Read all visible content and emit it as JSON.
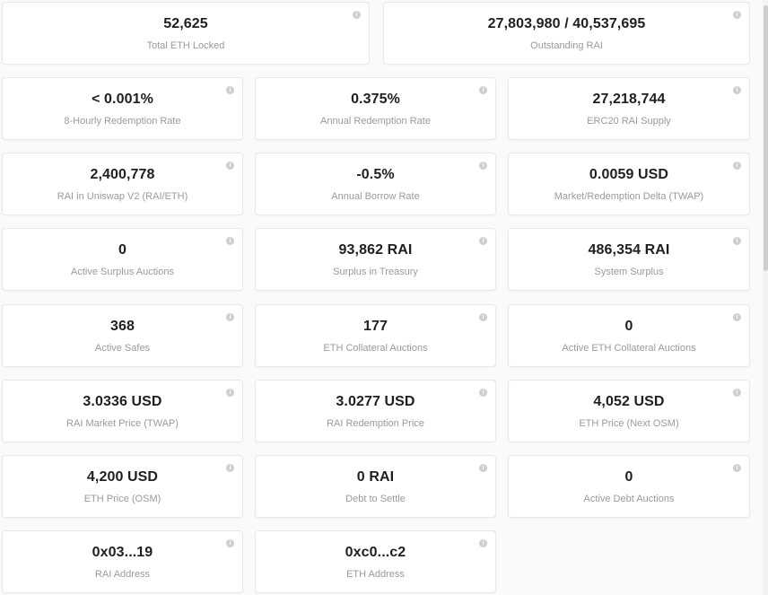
{
  "stats": {
    "total_eth_locked": {
      "value": "52,625",
      "label": "Total ETH Locked"
    },
    "outstanding_rai": {
      "value": "27,803,980 / 40,537,695",
      "label": "Outstanding RAI"
    },
    "hourly_redemption_rate": {
      "value": "< 0.001%",
      "label": "8-Hourly Redemption Rate"
    },
    "annual_redemption_rate": {
      "value": "0.375%",
      "label": "Annual Redemption Rate"
    },
    "erc20_rai_supply": {
      "value": "27,218,744",
      "label": "ERC20 RAI Supply"
    },
    "rai_in_uniswap": {
      "value": "2,400,778",
      "label": "RAI in Uniswap V2 (RAI/ETH)"
    },
    "annual_borrow_rate": {
      "value": "-0.5%",
      "label": "Annual Borrow Rate"
    },
    "market_redemption_delta": {
      "value": "0.0059 USD",
      "label": "Market/Redemption Delta (TWAP)"
    },
    "active_surplus_auctions": {
      "value": "0",
      "label": "Active Surplus Auctions"
    },
    "surplus_in_treasury": {
      "value": "93,862 RAI",
      "label": "Surplus in Treasury"
    },
    "system_surplus": {
      "value": "486,354 RAI",
      "label": "System Surplus"
    },
    "active_safes": {
      "value": "368",
      "label": "Active Safes"
    },
    "eth_collateral_auctions": {
      "value": "177",
      "label": "ETH Collateral Auctions"
    },
    "active_eth_collateral_auctions": {
      "value": "0",
      "label": "Active ETH Collateral Auctions"
    },
    "rai_market_price": {
      "value": "3.0336 USD",
      "label": "RAI Market Price (TWAP)"
    },
    "rai_redemption_price": {
      "value": "3.0277 USD",
      "label": "RAI Redemption Price"
    },
    "eth_price_next_osm": {
      "value": "4,052 USD",
      "label": "ETH Price (Next OSM)"
    },
    "eth_price_osm": {
      "value": "4,200 USD",
      "label": "ETH Price (OSM)"
    },
    "debt_to_settle": {
      "value": "0 RAI",
      "label": "Debt to Settle"
    },
    "active_debt_auctions": {
      "value": "0",
      "label": "Active Debt Auctions"
    },
    "rai_address": {
      "value": "0x03...19",
      "label": "RAI Address"
    },
    "eth_address": {
      "value": "0xc0...c2",
      "label": "ETH Address"
    }
  },
  "icons": {
    "info": "info-icon",
    "info_glyph": "i"
  },
  "colors": {
    "background": "#fafafa",
    "card": "#ffffff",
    "value_text": "#1f1f1f",
    "label_text": "#9a9a9a",
    "info_icon": "#cfcfcf"
  }
}
